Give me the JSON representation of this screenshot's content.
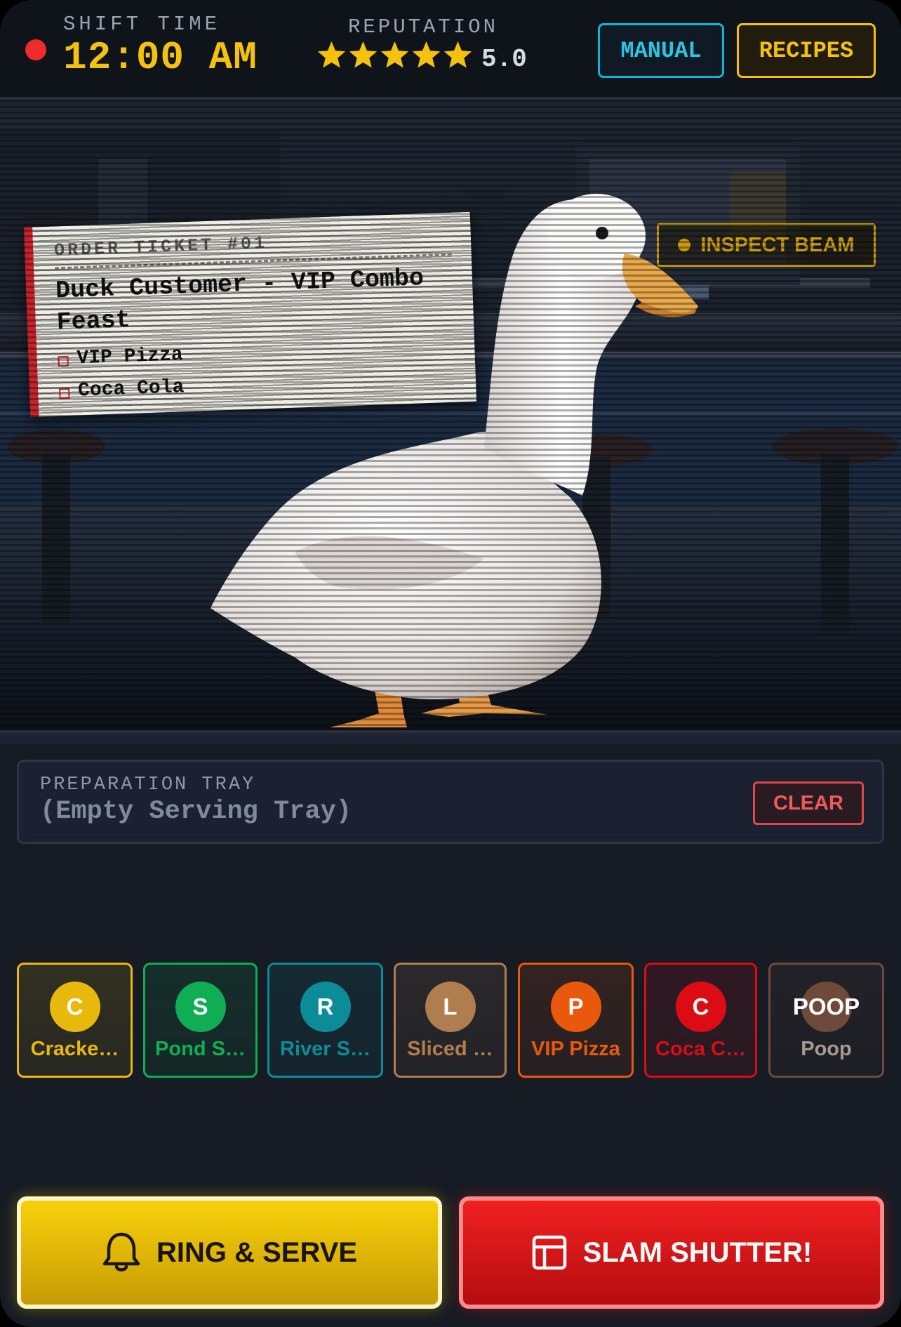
{
  "header": {
    "shift_label": "SHIFT TIME",
    "shift_time": "12:00 AM",
    "reputation_label": "REPUTATION",
    "reputation_stars": 5,
    "reputation_value": "5.0",
    "manual_label": "MANUAL",
    "recipes_label": "RECIPES"
  },
  "scene": {
    "inspect_label": "INSPECT BEAM",
    "ticket": {
      "number": "ORDER TICKET #01",
      "title": "Duck Customer - VIP Combo Feast",
      "items": [
        "VIP Pizza",
        "Coca Cola"
      ]
    }
  },
  "tray": {
    "label": "PREPARATION TRAY",
    "empty_text": "(Empty Serving Tray)",
    "clear_label": "CLEAR"
  },
  "ingredients": [
    {
      "initial": "C",
      "label": "Cracke…",
      "color": "#e8b90c"
    },
    {
      "initial": "S",
      "label": "Pond S…",
      "color": "#0fae55"
    },
    {
      "initial": "R",
      "label": "River S…",
      "color": "#0c8c98"
    },
    {
      "initial": "L",
      "label": "Sliced …",
      "color": "#b07d4e"
    },
    {
      "initial": "P",
      "label": "VIP Pizza",
      "color": "#ea580c"
    },
    {
      "initial": "C",
      "label": "Coca C…",
      "color": "#dc0c14"
    },
    {
      "initial": "POOP",
      "label": "Poop",
      "color": "#6e4a3a"
    }
  ],
  "actions": {
    "serve_label": "RING & SERVE",
    "slam_label": "SLAM SHUTTER!"
  }
}
